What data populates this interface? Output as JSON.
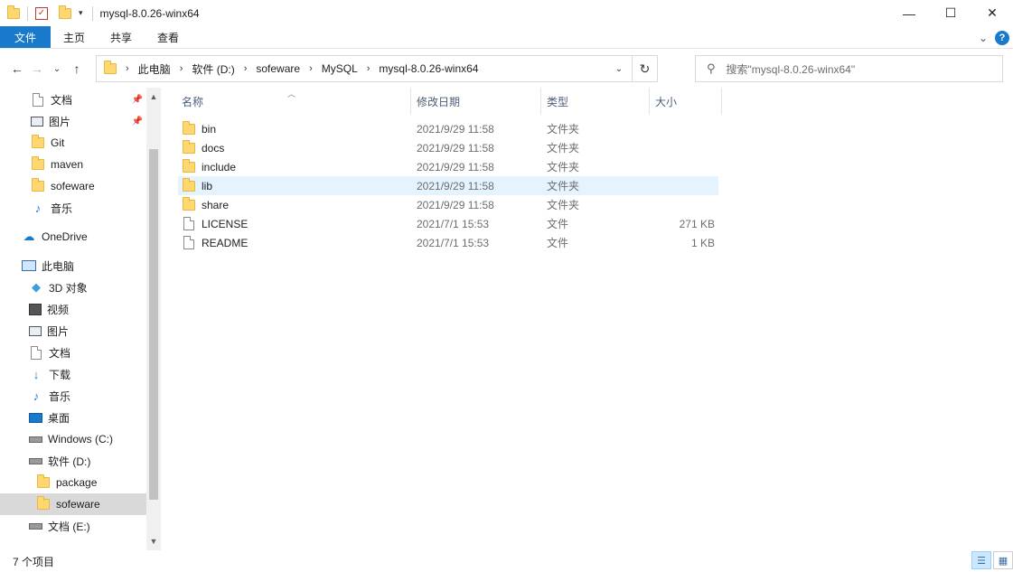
{
  "window": {
    "title": "mysql-8.0.26-winx64",
    "controls": {
      "minimize": "—",
      "maximize": "☐",
      "close": "✕"
    }
  },
  "ribbon": {
    "tabs": [
      "文件",
      "主页",
      "共享",
      "查看"
    ],
    "collapse": "⌄",
    "help": "?"
  },
  "nav": {
    "back": "←",
    "forward": "→",
    "recent": "⌄",
    "up": "↑"
  },
  "address": {
    "crumbs": [
      "此电脑",
      "软件 (D:)",
      "sofeware",
      "MySQL",
      "mysql-8.0.26-winx64"
    ],
    "refresh": "↻"
  },
  "search": {
    "placeholder": "搜索\"mysql-8.0.26-winx64\""
  },
  "sidebar": {
    "items": [
      {
        "label": "文档",
        "icon": "document-icon",
        "pinned": true
      },
      {
        "label": "图片",
        "icon": "pictures-icon",
        "pinned": true
      },
      {
        "label": "Git",
        "icon": "folder-icon"
      },
      {
        "label": "maven",
        "icon": "folder-icon"
      },
      {
        "label": "sofeware",
        "icon": "folder-icon"
      },
      {
        "label": "音乐",
        "icon": "music-icon"
      },
      {
        "label": "OneDrive",
        "icon": "cloud-icon"
      },
      {
        "label": "此电脑",
        "icon": "computer-icon"
      },
      {
        "label": "3D 对象",
        "icon": "cube-icon"
      },
      {
        "label": "视频",
        "icon": "video-icon"
      },
      {
        "label": "图片",
        "icon": "pictures-icon"
      },
      {
        "label": "文档",
        "icon": "document-icon"
      },
      {
        "label": "下载",
        "icon": "download-icon"
      },
      {
        "label": "音乐",
        "icon": "music-icon"
      },
      {
        "label": "桌面",
        "icon": "desktop-icon"
      },
      {
        "label": "Windows (C:)",
        "icon": "drive-icon"
      },
      {
        "label": "软件 (D:)",
        "icon": "drive-icon"
      },
      {
        "label": "package",
        "icon": "folder-icon"
      },
      {
        "label": "sofeware",
        "icon": "folder-icon",
        "selected": true
      },
      {
        "label": "文档 (E:)",
        "icon": "drive-icon"
      }
    ]
  },
  "columns": {
    "name": "名称",
    "date": "修改日期",
    "type": "类型",
    "size": "大小"
  },
  "files": [
    {
      "name": "bin",
      "date": "2021/9/29 11:58",
      "type": "文件夹",
      "size": "",
      "kind": "folder"
    },
    {
      "name": "docs",
      "date": "2021/9/29 11:58",
      "type": "文件夹",
      "size": "",
      "kind": "folder"
    },
    {
      "name": "include",
      "date": "2021/9/29 11:58",
      "type": "文件夹",
      "size": "",
      "kind": "folder"
    },
    {
      "name": "lib",
      "date": "2021/9/29 11:58",
      "type": "文件夹",
      "size": "",
      "kind": "folder",
      "hover": true
    },
    {
      "name": "share",
      "date": "2021/9/29 11:58",
      "type": "文件夹",
      "size": "",
      "kind": "folder"
    },
    {
      "name": "LICENSE",
      "date": "2021/7/1 15:53",
      "type": "文件",
      "size": "271 KB",
      "kind": "file"
    },
    {
      "name": "README",
      "date": "2021/7/1 15:53",
      "type": "文件",
      "size": "1 KB",
      "kind": "file"
    }
  ],
  "status": {
    "count": "7 个项目"
  },
  "colors": {
    "accent": "#1979ca",
    "hover_row": "#e5f3ff",
    "selected_side": "#d9d9d9"
  }
}
